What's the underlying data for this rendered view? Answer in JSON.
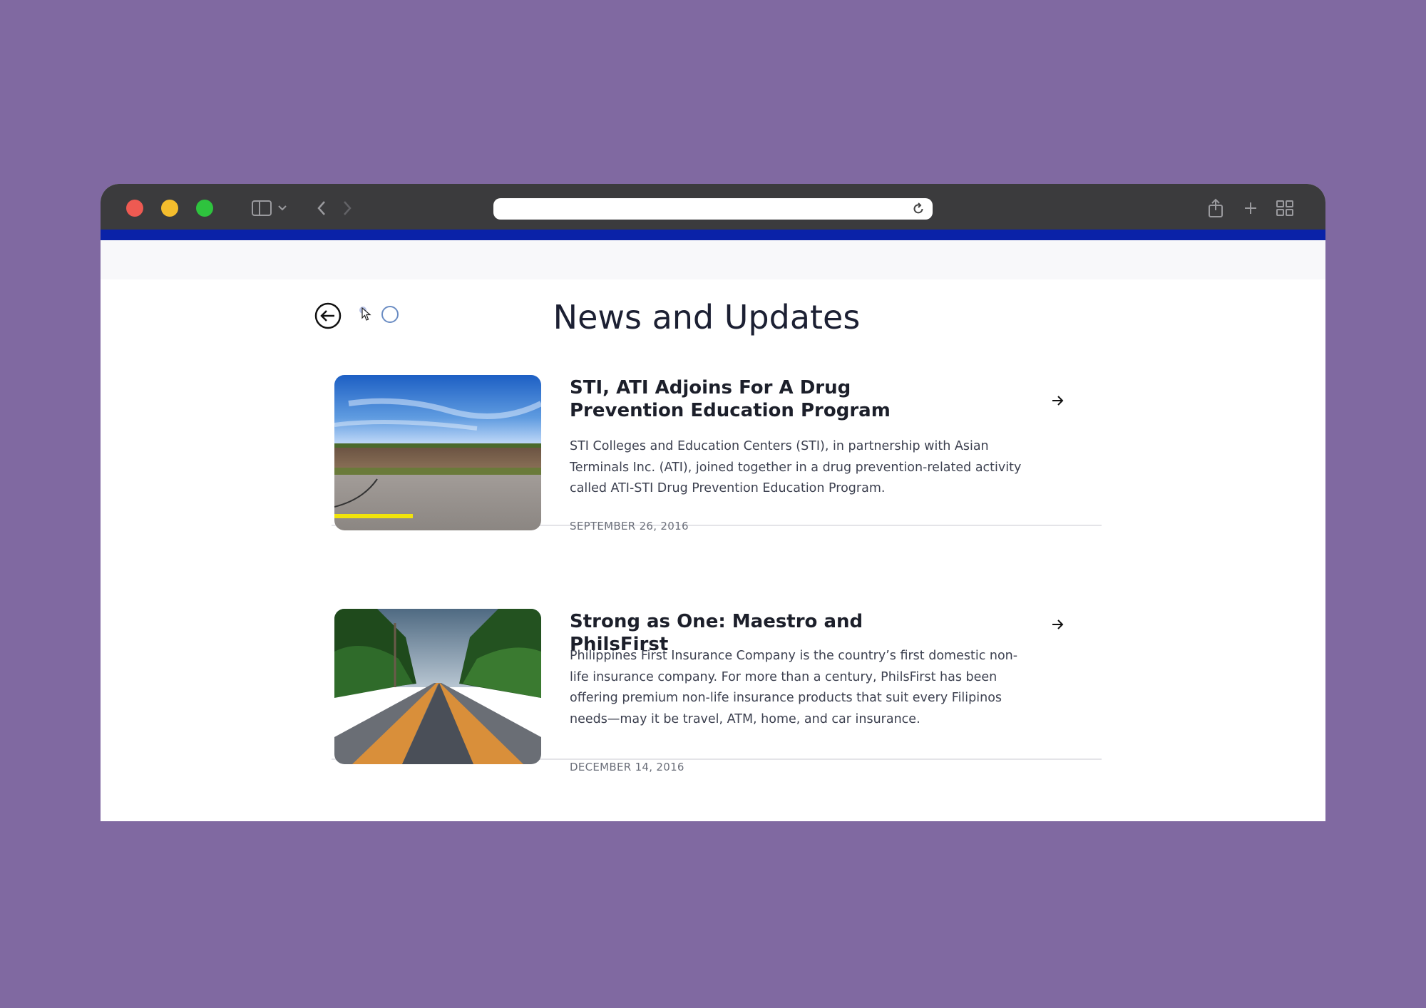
{
  "browser": {
    "url": "",
    "icons": [
      "sidebar-icon",
      "chevron-down-icon",
      "back-icon",
      "forward-icon",
      "reload-icon",
      "share-icon",
      "new-tab-icon",
      "tab-overview-icon"
    ]
  },
  "page": {
    "title": "News and Updates"
  },
  "articles": [
    {
      "title": "STI, ATI Adjoins For A Drug Prevention Education Program",
      "body": "STI Colleges and Education Centers (STI), in partnership with Asian Terminals Inc. (ATI), joined together in a drug prevention-related activity called ATI-STI Drug Prevention Education Program.",
      "date": "SEPTEMBER 26, 2016"
    },
    {
      "title": "Strong as One: Maestro and PhilsFirst",
      "body": "Philippines First Insurance Company is the country’s first domestic non-life insurance company. For more than a century, PhilsFirst has been offering premium non-life insurance products that suit every Filipinos needs—may it be travel, ATM, home, and car insurance.",
      "date": "DECEMBER 14, 2016"
    }
  ],
  "colors": {
    "background": "#8069a1",
    "toolbar": "#3b3b3d",
    "accent": "#0a22a8",
    "title": "#1c2033"
  }
}
